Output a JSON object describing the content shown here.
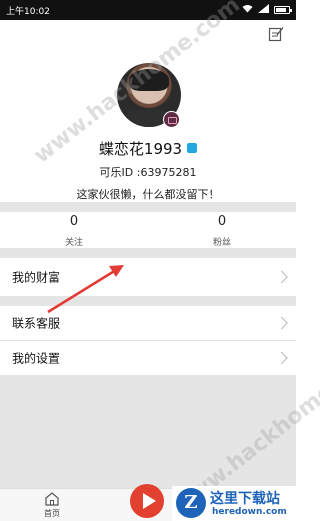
{
  "status_bar": {
    "time": "上午10:02"
  },
  "profile": {
    "nickname": "蝶恋花1993",
    "user_id": "可乐ID :63975281",
    "signature": "这家伙很懒，什么都没留下！"
  },
  "stats": [
    {
      "value": "0",
      "label": "关注"
    },
    {
      "value": "0",
      "label": "粉丝"
    }
  ],
  "menu": [
    {
      "label": "我的财富"
    },
    {
      "label": "联系客服"
    },
    {
      "label": "我的设置"
    }
  ],
  "bottom_nav": {
    "home_label": "首页"
  },
  "watermarks": [
    "www.hackhome.com",
    "www.hackhome.com"
  ],
  "brand": {
    "title": "这里下载站",
    "url": "heredown.com"
  },
  "colors": {
    "annotation_arrow": "#e23b35",
    "play_button": "#e2412f",
    "brand_blue": "#1e63b8"
  }
}
